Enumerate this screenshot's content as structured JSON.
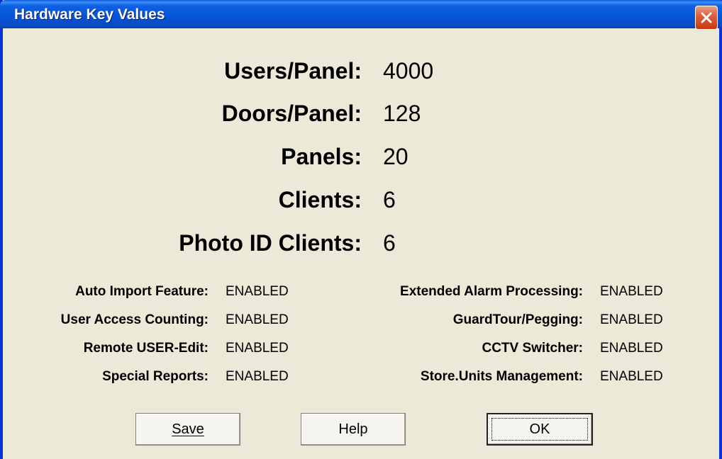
{
  "window": {
    "title": "Hardware Key Values"
  },
  "counts": [
    {
      "label": "Users/Panel:",
      "value": "4000"
    },
    {
      "label": "Doors/Panel:",
      "value": "128"
    },
    {
      "label": "Panels:",
      "value": "20"
    },
    {
      "label": "Clients:",
      "value": "6"
    },
    {
      "label": "Photo ID Clients:",
      "value": "6"
    }
  ],
  "features_left": [
    {
      "label": "Auto Import Feature:",
      "value": "ENABLED"
    },
    {
      "label": "User Access Counting:",
      "value": "ENABLED"
    },
    {
      "label": "Remote USER-Edit:",
      "value": "ENABLED"
    },
    {
      "label": "Special Reports:",
      "value": "ENABLED"
    }
  ],
  "features_right": [
    {
      "label": "Extended Alarm Processing:",
      "value": "ENABLED"
    },
    {
      "label": "GuardTour/Pegging:",
      "value": "ENABLED"
    },
    {
      "label": "CCTV Switcher:",
      "value": "ENABLED"
    },
    {
      "label": "Store.Units Management:",
      "value": "ENABLED"
    }
  ],
  "buttons": {
    "save_label": "Save",
    "help_label": "Help",
    "ok_label": "OK"
  },
  "colors": {
    "titlebar": "#0553d6",
    "close": "#e0603a",
    "background": "#ece9d8"
  }
}
